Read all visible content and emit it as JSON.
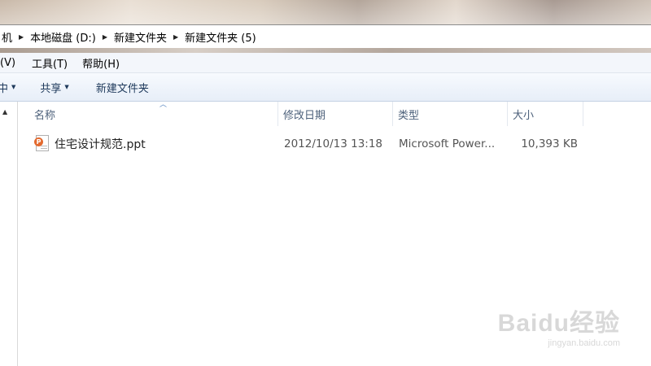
{
  "address_bar": {
    "crumbs": [
      "机",
      "本地磁盘 (D:)",
      "新建文件夹",
      "新建文件夹 (5)"
    ]
  },
  "menu": {
    "items": [
      "(V)",
      "工具(T)",
      "帮助(H)"
    ]
  },
  "command_bar": {
    "organize_fragment": "中",
    "share_label": "共享",
    "new_folder_label": "新建文件夹"
  },
  "columns": {
    "name": "名称",
    "date_modified": "修改日期",
    "type": "类型",
    "size": "大小"
  },
  "files": [
    {
      "name": "住宅设计规范.ppt",
      "date_modified": "2012/10/13 13:18",
      "type": "Microsoft Power...",
      "size": "10,393 KB",
      "icon": "powerpoint-file-icon"
    }
  ],
  "watermark": {
    "logo": "Baidu经验",
    "url": "jingyan.baidu.com"
  }
}
